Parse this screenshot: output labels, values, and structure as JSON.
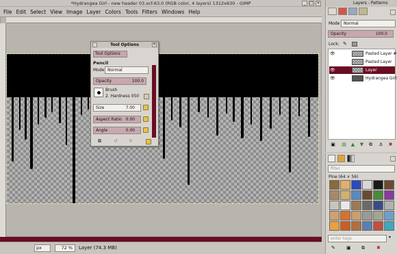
{
  "window": {
    "title": "*Hydrangea Girl - new header 03.xcf-63.0 (RGB color, 4 layers) 1312x630 - GIMP",
    "controls": [
      "_",
      "□",
      "×"
    ]
  },
  "menu": [
    "File",
    "Edit",
    "Select",
    "View",
    "Image",
    "Layer",
    "Colors",
    "Tools",
    "Filters",
    "Windows",
    "Help"
  ],
  "status": {
    "unit": "px",
    "zoom": "72 %",
    "layer_info": "Layer (74.3 MB)"
  },
  "tool_options": {
    "title": "Tool Options",
    "tab_label": "Tool Options",
    "tool_name": "Pencil",
    "mode_label": "Mode:",
    "mode_value": "Normal",
    "opacity_label": "Opacity",
    "opacity_value": "100.0",
    "brush_label": "Brush",
    "brush_value": "2. Hardness 050",
    "size_label": "Size",
    "size_value": "7.00",
    "aspect_label": "Aspect Ratio",
    "aspect_value": "0.00",
    "angle_label": "Angle",
    "angle_value": "0.00"
  },
  "layers_panel": {
    "title": "Layers - Patterns",
    "mode_label": "Mode",
    "mode_value": "Normal",
    "opacity_label": "Opacity",
    "opacity_value": "100.0",
    "lock_label": "Lock:",
    "layers": [
      {
        "name": "Pasted Layer #",
        "visible": true,
        "selected": false
      },
      {
        "name": "Pasted Layer",
        "visible": false,
        "selected": false
      },
      {
        "name": "Layer",
        "visible": true,
        "selected": true
      },
      {
        "name": "Hydrangea Girl",
        "visible": true,
        "selected": false
      }
    ]
  },
  "patterns_panel": {
    "filter_placeholder": "filter",
    "pattern_name": "Pine (64 × 56)",
    "tags_placeholder": "enter tags"
  },
  "colors": {
    "accent": "#6a0d22",
    "pink_field": "#c9a7ae",
    "chrome": "#c8c4bf"
  }
}
